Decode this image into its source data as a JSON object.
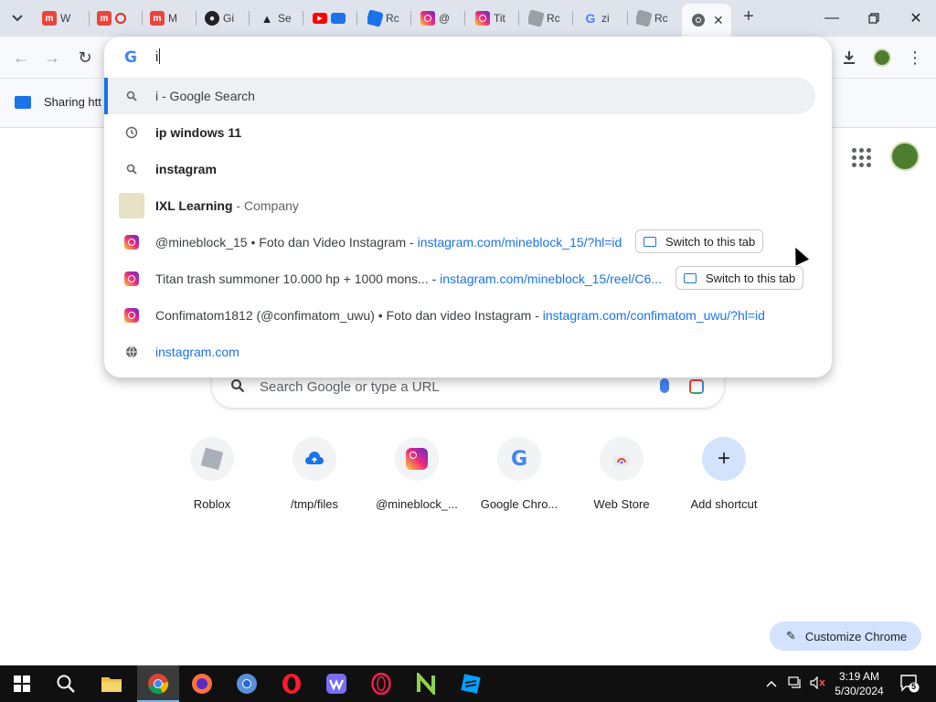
{
  "tabs": [
    {
      "title": "W",
      "icon": "m-icon",
      "color": "#e8453c"
    },
    {
      "title": "",
      "icon": "m-icon",
      "color": "#e8453c"
    },
    {
      "title": "M",
      "icon": "m-icon",
      "color": "#e8453c"
    },
    {
      "title": "Gi",
      "icon": "github-icon",
      "color": "#202124"
    },
    {
      "title": "Se",
      "icon": "flask-icon",
      "color": "#202124"
    },
    {
      "title": "",
      "icon": "youtube-icon",
      "color": "#ff0000"
    },
    {
      "title": "Rc",
      "icon": "roblox-icon",
      "color": "#1a73e8"
    },
    {
      "title": "@",
      "icon": "instagram-icon",
      "color": "#e1306c"
    },
    {
      "title": "Tit",
      "icon": "instagram-icon",
      "color": "#e1306c"
    },
    {
      "title": "Rc",
      "icon": "roblox-icon",
      "color": "#9aa0a6"
    },
    {
      "title": "zi",
      "icon": "google-icon",
      "color": "#4285f4"
    },
    {
      "title": "Rc",
      "icon": "roblox-icon",
      "color": "#9aa0a6"
    }
  ],
  "omnibox": {
    "typed": "i",
    "suggestions": [
      {
        "type": "search",
        "bold": "",
        "rest": "i - Google Search",
        "selected": true
      },
      {
        "type": "history",
        "bold": "ip windows 11",
        "rest": ""
      },
      {
        "type": "search",
        "bold": "instagram",
        "rest": ""
      },
      {
        "type": "entity",
        "bold": "IXL Learning",
        "rest": " - Company"
      },
      {
        "type": "tab",
        "text": "@mineblock_15 • Foto dan Video Instagram",
        "sep": " - ",
        "url": "instagram.com/mineblock_15/?hl=id",
        "button": "Switch to this tab"
      },
      {
        "type": "tab",
        "text": "Titan trash summoner 10.000 hp + 1000 mons...",
        "sep": " - ",
        "url": "instagram.com/mineblock_15/reel/C6...",
        "button": "Switch to this tab"
      },
      {
        "type": "bookmark",
        "text": "Confimatom1812 (@confimatom_uwu) • Foto dan video Instagram",
        "sep": " - ",
        "url": "instagram.com/confimatom_uwu/?hl=id"
      },
      {
        "type": "url",
        "url": "instagram.com"
      }
    ]
  },
  "bookmark_bar": {
    "label": "Sharing htt"
  },
  "ntp": {
    "search_placeholder": "Search Google or type a URL",
    "shortcuts": [
      {
        "label": "Roblox",
        "icon": "roblox-icon"
      },
      {
        "label": "/tmp/files",
        "icon": "cloud-upload-icon"
      },
      {
        "label": "@mineblock_...",
        "icon": "instagram-icon"
      },
      {
        "label": "Google Chro...",
        "icon": "google-icon"
      },
      {
        "label": "Web Store",
        "icon": "web-store-icon"
      },
      {
        "label": "Add shortcut",
        "icon": "plus-icon"
      }
    ],
    "customize_label": "Customize Chrome"
  },
  "taskbar": {
    "time": "3:19 AM",
    "date": "5/30/2024",
    "notifications": "5"
  }
}
